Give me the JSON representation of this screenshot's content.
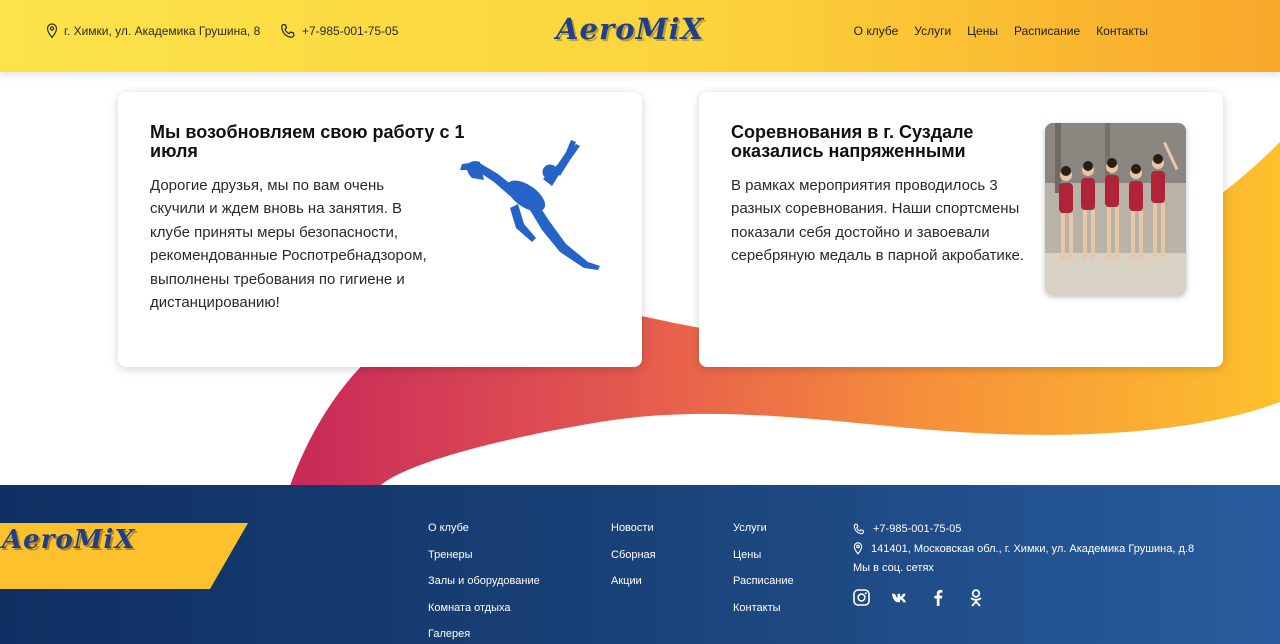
{
  "header": {
    "address": "г. Химки, ул. Академика Грушина, 8",
    "phone": "+7-985-001-75-05",
    "logo": "AeroMiX",
    "nav": [
      "О клубе",
      "Услуги",
      "Цены",
      "Расписание",
      "Контакты"
    ]
  },
  "cards": [
    {
      "title": "Мы возобновляем свою работу с 1 июля",
      "text": "Дорогие друзья, мы по вам очень скучили и ждем вновь на занятия. В клубе приняты меры безопасности, рекомендованные Роспотребнадзором, выполнены требования по гигиене и дистанцированию!",
      "image": "gymnast-silhouette"
    },
    {
      "title": "Соревнования в г. Суздале оказались напряженными",
      "text": "В рамках мероприятия проводилось 3 разных соревнования. Наши спортсмены показали себя достойно и завоевали серебряную медаль в парной акробатике.",
      "image": "athletes-photo"
    }
  ],
  "footer": {
    "logo": "AeroMiX",
    "col1": [
      "О клубе",
      "Тренеры",
      "Залы и оборудование",
      "Комната отдыха",
      "Галерея"
    ],
    "col2": [
      "Новости",
      "Сборная",
      "Акции"
    ],
    "col3": [
      "Услуги",
      "Цены",
      "Расписание",
      "Контакты"
    ],
    "phone": "+7-985-001-75-05",
    "address": "141401, Московская обл., г. Химки, ул. Академика Грушина, д.8",
    "social_title": "Мы в соц. сетях",
    "socials": [
      "instagram-icon",
      "vk-icon",
      "facebook-icon",
      "odnoklassniki-icon"
    ]
  },
  "colors": {
    "header_yellow": "#fcd43c",
    "accent_orange": "#f9a72a",
    "accent_red": "#d9364f",
    "brand_blue": "#1f3f8e",
    "footer_navy": "#0f2f63"
  }
}
